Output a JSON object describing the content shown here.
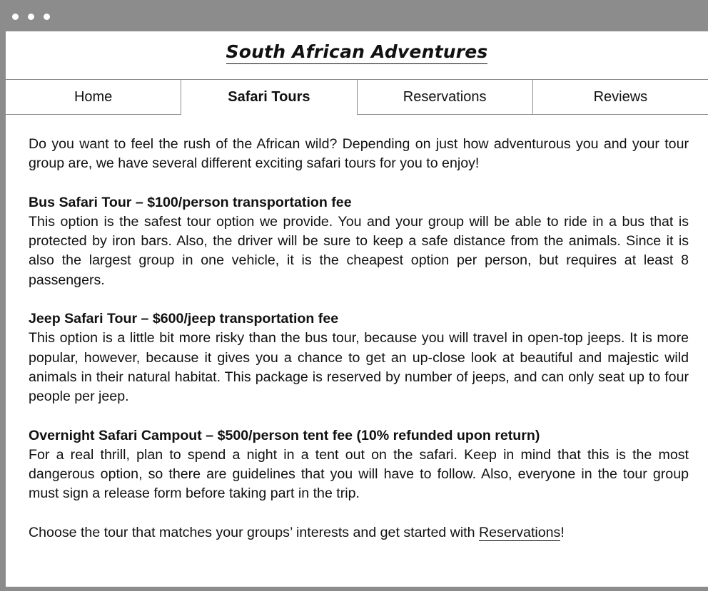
{
  "site": {
    "title": "South African Adventures"
  },
  "tabs": [
    {
      "label": "Home",
      "active": false
    },
    {
      "label": "Safari Tours",
      "active": true
    },
    {
      "label": "Reservations",
      "active": false
    },
    {
      "label": "Reviews",
      "active": false
    }
  ],
  "content": {
    "intro": "Do you want to feel the rush of the African wild? Depending on just how adventurous you and your tour group are, we have several different exciting safari tours for you to enjoy!",
    "sections": [
      {
        "heading": "Bus Safari Tour – $100/person transportation fee",
        "body": "This option is the safest tour option we provide. You and your group will be able to ride in a bus that is protected by iron bars. Also, the driver will be sure to keep a safe distance from the animals. Since it is also the largest group in one vehicle, it is the cheapest option per person, but requires at least 8 passengers."
      },
      {
        "heading": "Jeep Safari Tour – $600/jeep transportation fee",
        "body": "This option is a little bit more risky than the bus tour, because you will travel in open-top jeeps. It is more popular, however, because it gives you a chance to get an up-close look at beautiful and majestic wild animals in their natural habitat. This package is reserved by number of jeeps, and can only seat up to four people per jeep."
      },
      {
        "heading": "Overnight Safari Campout – $500/person tent fee (10% refunded upon return)",
        "body": "For a real thrill, plan to spend a night in a tent out on the safari. Keep in mind that this is the most dangerous option, so there are guidelines that you will have to follow. Also, everyone in the tour group must sign a release form before taking part in the trip."
      }
    ],
    "closing_prefix": "Choose the tour that matches your groups’ interests and get started with ",
    "closing_link": "Reservations",
    "closing_suffix": "!"
  }
}
